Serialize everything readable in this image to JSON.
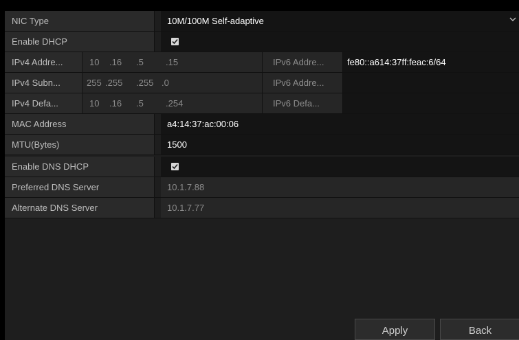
{
  "nic_type": {
    "label": "NIC Type",
    "value": "10M/100M Self-adaptive"
  },
  "enable_dhcp": {
    "label": "Enable DHCP",
    "checked": true
  },
  "ipv4": [
    {
      "label": "IPv4 Addre...",
      "octets": [
        "10",
        ".16",
        ".5",
        ".15"
      ],
      "v6_label": "IPv6 Addre...",
      "v6_value": "fe80::a614:37ff:feac:6/64"
    },
    {
      "label": "IPv4 Subn...",
      "octets": [
        "255",
        ".255",
        ".255",
        ".0"
      ],
      "v6_label": "IPv6 Addre...",
      "v6_value": ""
    },
    {
      "label": "IPv4 Defa...",
      "octets": [
        "10",
        ".16",
        ".5",
        ".254"
      ],
      "v6_label": "IPv6 Defa...",
      "v6_value": ""
    }
  ],
  "mac": {
    "label": "MAC Address",
    "value": "a4:14:37:ac:00:06"
  },
  "mtu": {
    "label": "MTU(Bytes)",
    "value": "1500"
  },
  "enable_dns_dhcp": {
    "label": "Enable DNS DHCP",
    "checked": true
  },
  "preferred_dns": {
    "label": "Preferred DNS Server",
    "value": "10.1.7.88"
  },
  "alternate_dns": {
    "label": "Alternate DNS Server",
    "value": "10.1.7.77"
  },
  "buttons": {
    "apply": "Apply",
    "back": "Back"
  },
  "icons": {
    "dropdown": "chevron-down-icon",
    "check": "checkmark-icon"
  }
}
